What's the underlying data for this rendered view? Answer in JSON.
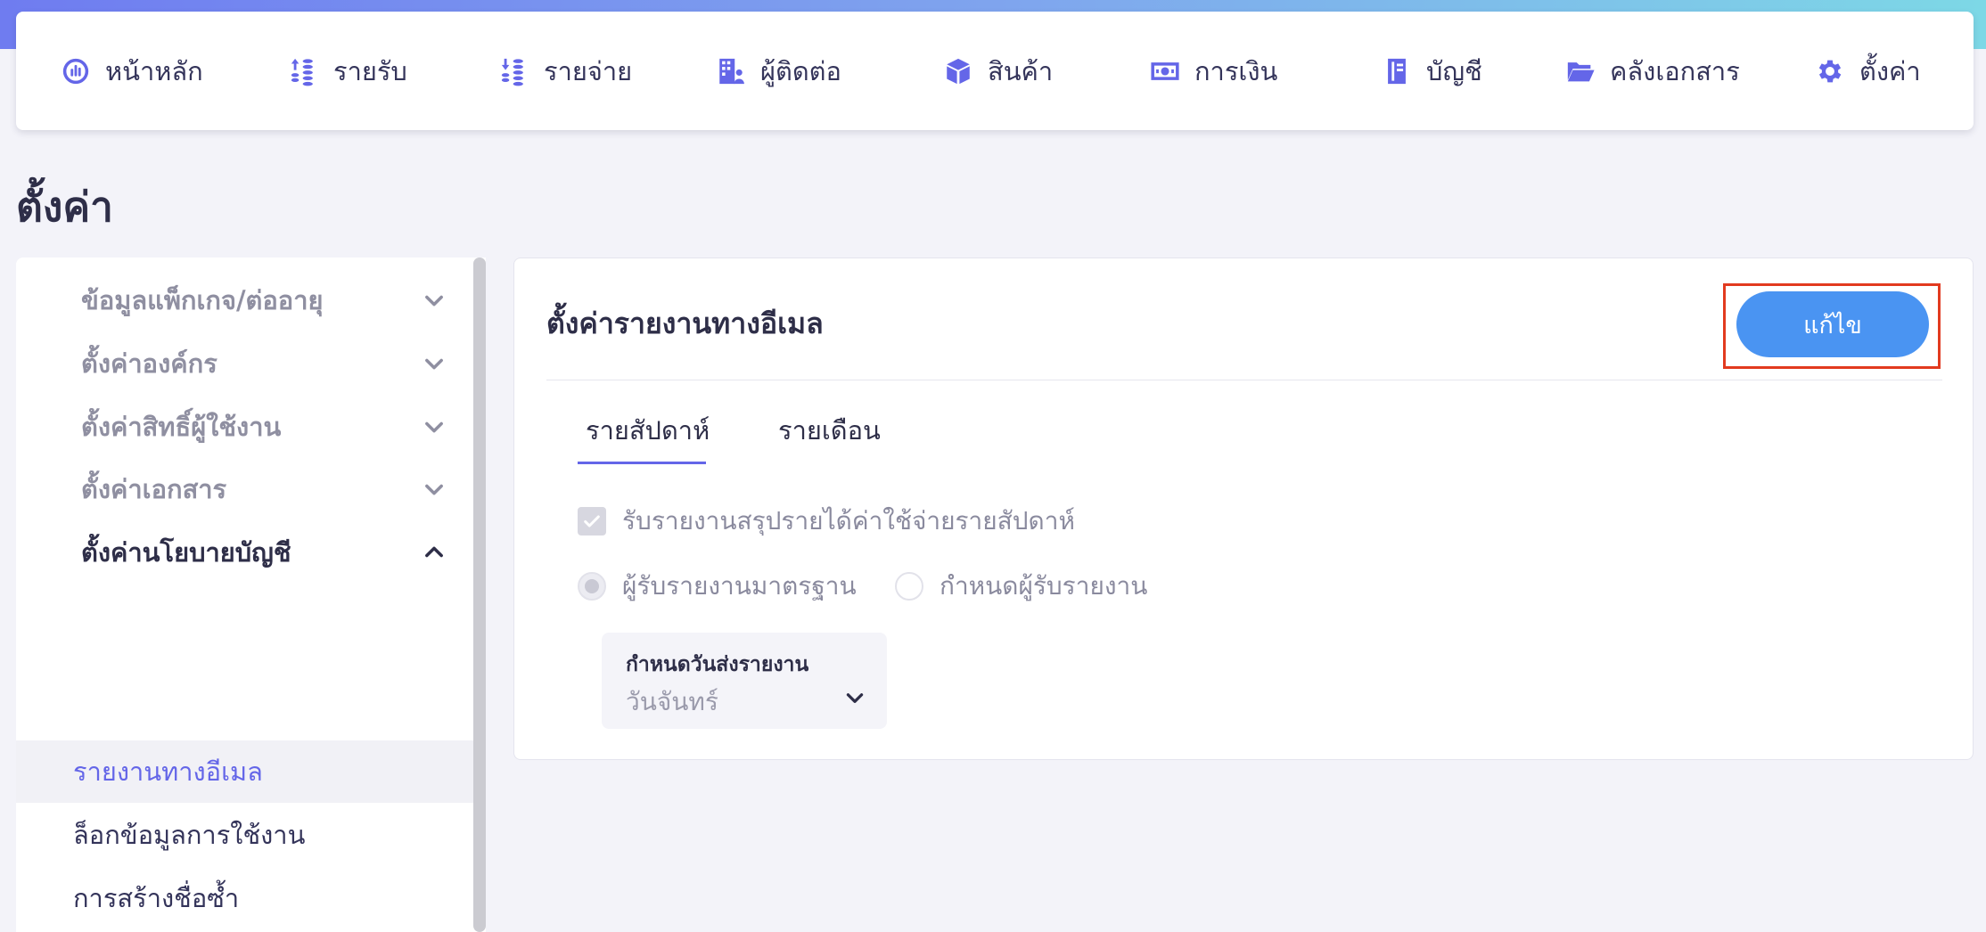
{
  "nav": {
    "items": [
      {
        "label": "หน้าหลัก",
        "icon": "dashboard-icon"
      },
      {
        "label": "รายรับ",
        "icon": "income-icon"
      },
      {
        "label": "รายจ่าย",
        "icon": "expense-icon"
      },
      {
        "label": "ผู้ติดต่อ",
        "icon": "contacts-icon"
      },
      {
        "label": "สินค้า",
        "icon": "product-box-icon"
      },
      {
        "label": "การเงิน",
        "icon": "money-icon"
      },
      {
        "label": "บัญชี",
        "icon": "accounting-book-icon"
      },
      {
        "label": "คลังเอกสาร",
        "icon": "folder-icon"
      },
      {
        "label": "ตั้งค่า",
        "icon": "gear-icon"
      }
    ]
  },
  "page": {
    "title": "ตั้งค่า"
  },
  "sidebar": {
    "sections": [
      {
        "label": "ข้อมูลแพ็กเกจ/ต่ออายุ",
        "expanded": false
      },
      {
        "label": "ตั้งค่าองค์กร",
        "expanded": false
      },
      {
        "label": "ตั้งค่าสิทธิ์ผู้ใช้งาน",
        "expanded": false
      },
      {
        "label": "ตั้งค่าเอกสาร",
        "expanded": false
      },
      {
        "label": "ตั้งค่านโยบายบัญชี",
        "expanded": true
      }
    ],
    "sub_items": [
      {
        "label": "รายงานทางอีเมล",
        "active": true
      },
      {
        "label": "ล็อกข้อมูลการใช้งาน",
        "active": false
      },
      {
        "label": "การสร้างชื่อซ้ำ",
        "active": false
      }
    ]
  },
  "card": {
    "title": "ตั้งค่ารายงานทางอีเมล",
    "edit_label": "แก้ไข",
    "tabs": [
      {
        "label": "รายสัปดาห์",
        "active": true
      },
      {
        "label": "รายเดือน",
        "active": false
      }
    ],
    "checkbox": {
      "label": "รับรายงานสรุปรายได้ค่าใช้จ่ายรายสัปดาห์",
      "checked": true
    },
    "radios": [
      {
        "label": "ผู้รับรายงานมาตรฐาน",
        "checked": true
      },
      {
        "label": "กำหนดผู้รับรายงาน",
        "checked": false
      }
    ],
    "select": {
      "label": "กำหนดวันส่งรายงาน",
      "value": "วันจันทร์"
    }
  },
  "colors": {
    "accent": "#6466e8",
    "button": "#4a94f2",
    "highlight": "#e23a1f"
  }
}
